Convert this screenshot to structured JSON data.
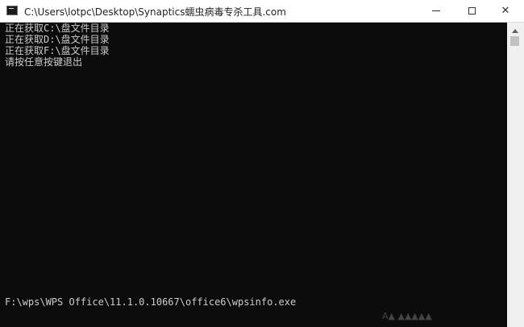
{
  "window": {
    "title": "C:\\Users\\lotpc\\Desktop\\Synaptics蠕虫病毒专杀工具.com",
    "icon": "console-app-icon",
    "controls": {
      "minimize_icon": "minimize-icon",
      "maximize_icon": "maximize-icon",
      "close_label": "✕"
    }
  },
  "console": {
    "lines": [
      "正在获取C:\\盘文件目录",
      "正在获取D:\\盘文件目录",
      "正在获取F:\\盘文件目录",
      "请按任意按键退出"
    ],
    "bottom_line": "F:\\wps\\WPS Office\\11.1.0.10667\\office6\\wpsinfo.exe",
    "text_color": "#cccccc",
    "background": "#0c0c0c"
  },
  "watermark": {
    "text": "A▲ ▲▲▲▲▲"
  }
}
